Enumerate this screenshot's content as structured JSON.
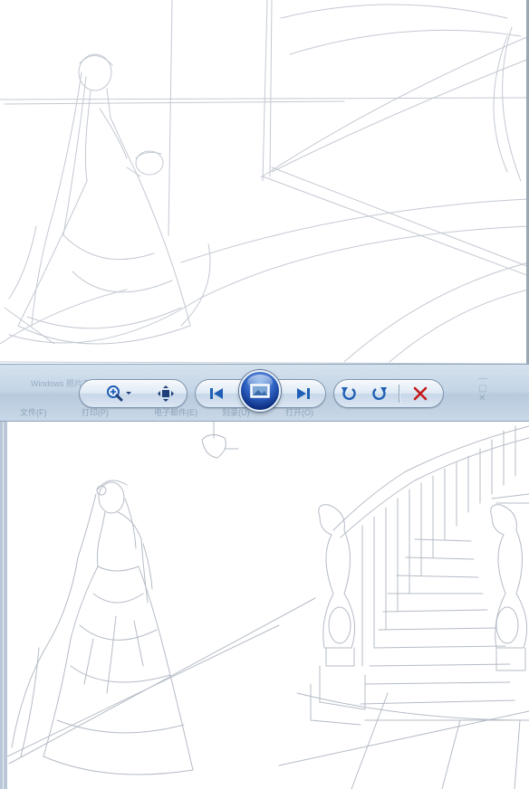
{
  "window": {
    "ghost_title": "Windows 照片查看器",
    "ghost_menu": [
      "文件(F)",
      "打印(P)",
      "电子邮件(E)",
      "刻录(U)",
      "打开(O)"
    ]
  },
  "toolbar": {
    "zoom": {
      "icon": "zoom-in-icon",
      "has_dropdown": true
    },
    "fit": {
      "icon": "fit-to-window-icon"
    },
    "previous": {
      "icon": "previous-icon"
    },
    "slideshow": {
      "icon": "slideshow-icon"
    },
    "next": {
      "icon": "next-icon"
    },
    "rotate_ccw": {
      "icon": "rotate-counterclockwise-icon"
    },
    "rotate_cw": {
      "icon": "rotate-clockwise-icon"
    },
    "delete": {
      "icon": "delete-icon",
      "color": "#c41a1a"
    }
  },
  "colors": {
    "toolbar_bg": "#c5d6e7",
    "accent_blue": "#1f5fb5",
    "sketch_line": "#b5bcc6"
  },
  "images": {
    "top": {
      "subject": "pencil sketch of a bride in a wedding gown with veil and bouquet, rough draft"
    },
    "bottom": {
      "subject": "cleaned pencil sketch of a bride beside a curved grand staircase"
    }
  }
}
